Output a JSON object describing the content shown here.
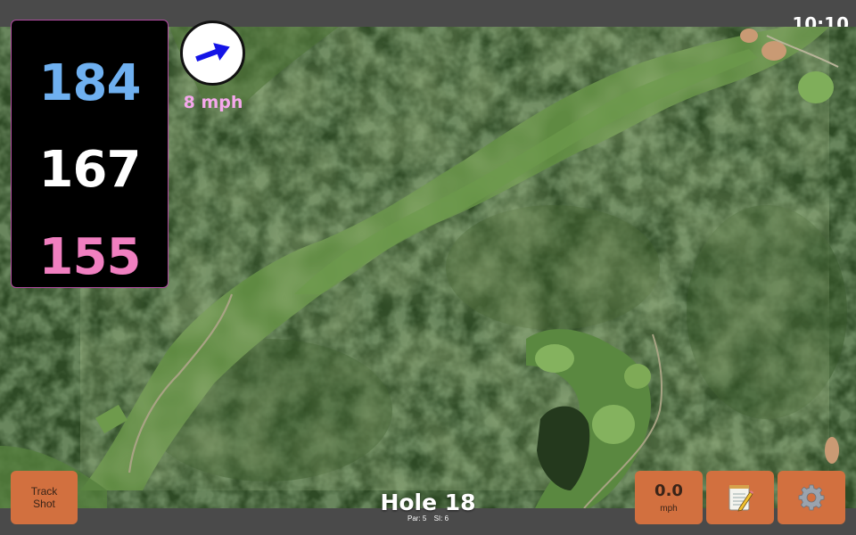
{
  "status_bar": {
    "clock": "10:10"
  },
  "distances": {
    "back": "184",
    "middle": "167",
    "front": "155",
    "back_color": "#6fb0f0",
    "middle_color": "#ffffff",
    "front_color": "#f07fc0"
  },
  "wind": {
    "speed_label": "8 mph",
    "label_color": "#f5a8ec",
    "arrow_color": "#1414e6",
    "direction_deg": 20,
    "icon": "wind-arrow-icon"
  },
  "buttons": {
    "track_shot_line1": "Track",
    "track_shot_line2": "Shot",
    "speed_value": "0.0",
    "speed_unit": "mph",
    "notes_icon": "notepad-icon",
    "settings_icon": "gear-icon",
    "button_color": "#d2703f"
  },
  "hole": {
    "title": "Hole 18",
    "par": "Par: 5",
    "si": "SI: 6"
  },
  "map": {
    "type": "satellite-aerial-golf-hole"
  }
}
